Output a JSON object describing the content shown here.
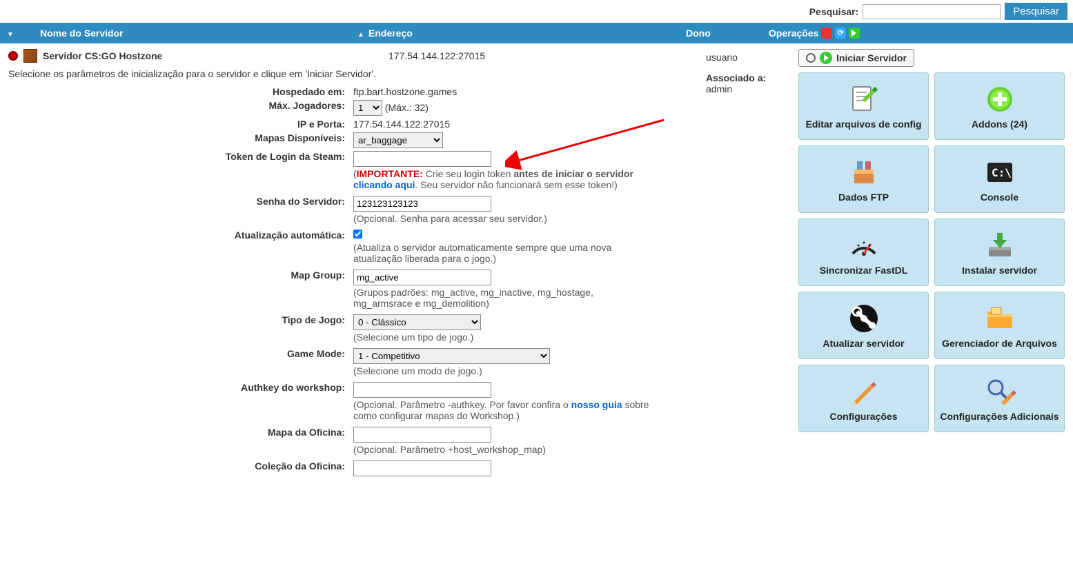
{
  "search": {
    "label": "Pesquisar:",
    "button": "Pesquisar",
    "value": ""
  },
  "headers": {
    "name": "Nome do Servidor",
    "addr": "Endereço",
    "owner": "Dono",
    "ops": "Operações"
  },
  "server": {
    "name": "Servidor CS:GO Hostzone",
    "addr": "177.54.144.122:27015",
    "owner": "usuario",
    "assoc_label": "Associado a:",
    "assoc_value": "admin",
    "start_label": "Iniciar Servidor"
  },
  "intro": "Selecione os parâmetros de inicialização para o servidor e clique em 'Iniciar Servidor'.",
  "form": {
    "hosted_label": "Hospedado em:",
    "hosted_value": "ftp.bart.hostzone.games",
    "maxp_label": "Máx. Jogadores:",
    "maxp_value": "1",
    "maxp_hint": "(Máx.: 32)",
    "ipport_label": "IP e Porta:",
    "ipport_value": "177.54.144.122:27015",
    "maps_label": "Mapas Disponíveis:",
    "maps_value": "ar_baggage",
    "token_label": "Token de Login da Steam:",
    "token_value": "",
    "token_warn": "IMPORTANTE:",
    "token_text1": " Crie seu login token ",
    "token_bold": "antes de iniciar o servidor ",
    "token_link": "clicando aqui",
    "token_text2": ". Seu servidor não funcionará sem esse token!)",
    "pass_label": "Senha do Servidor:",
    "pass_value": "123123123123",
    "pass_hint": "(Opcional. Senha para acessar seu servidor.)",
    "auto_label": "Atualização automática:",
    "auto_checked": true,
    "auto_hint": "(Atualiza o servidor automaticamente sempre que uma nova atualização liberada para o jogo.)",
    "mapgroup_label": "Map Group:",
    "mapgroup_value": "mg_active",
    "mapgroup_hint": "(Grupos padrões: mg_active, mg_inactive, mg_hostage, mg_armsrace e mg_demolition)",
    "gametype_label": "Tipo de Jogo:",
    "gametype_value": "0 - Clássico",
    "gametype_hint": "(Selecione um tipo de jogo.)",
    "gamemode_label": "Game Mode:",
    "gamemode_value": "1 - Competitivo",
    "gamemode_hint": "(Selecione um modo de jogo.)",
    "authkey_label": "Authkey do workshop:",
    "authkey_value": "",
    "authkey_hint1": "(Opcional. Parâmetro -authkey. Por favor confira o ",
    "authkey_link": "nosso guia",
    "authkey_hint2": " sobre como configurar mapas do Workshop.)",
    "wsmap_label": "Mapa da Oficina:",
    "wsmap_value": "",
    "wsmap_hint": "(Opcional. Parâmetro +host_workshop_map)",
    "wscol_label": "Coleção da Oficina:",
    "wscol_value": ""
  },
  "panels": {
    "edit": "Editar arquivos de config",
    "addons": "Addons (24)",
    "ftp": "Dados FTP",
    "console": "Console",
    "fastdl": "Sincronizar FastDL",
    "install": "Instalar servidor",
    "update": "Atualizar servidor",
    "files": "Gerenciador de Arquivos",
    "config": "Configurações",
    "config2": "Configurações Adicionais"
  }
}
